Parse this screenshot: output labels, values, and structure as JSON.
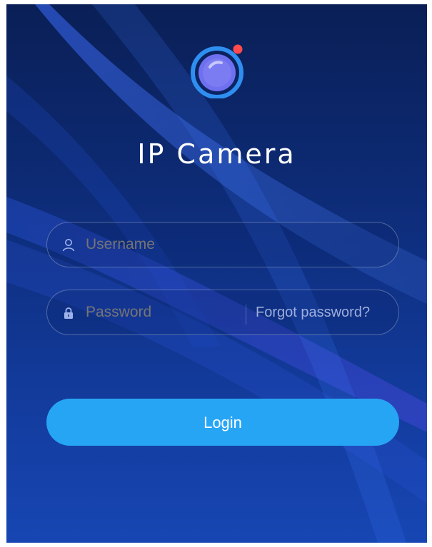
{
  "app": {
    "title": "IP Camera"
  },
  "form": {
    "username": {
      "placeholder": "Username",
      "value": ""
    },
    "password": {
      "placeholder": "Password",
      "value": ""
    },
    "forgot_label": "Forgot password?",
    "login_label": "Login"
  },
  "icons": {
    "logo": "camera-lens-icon",
    "username": "user-icon",
    "password": "lock-icon"
  },
  "colors": {
    "background_top": "#0a1f56",
    "background_bottom": "#1746b3",
    "button": "#27a5f5",
    "logo_ring": "#2f8ff0",
    "logo_dot": "#ff4b4b"
  }
}
